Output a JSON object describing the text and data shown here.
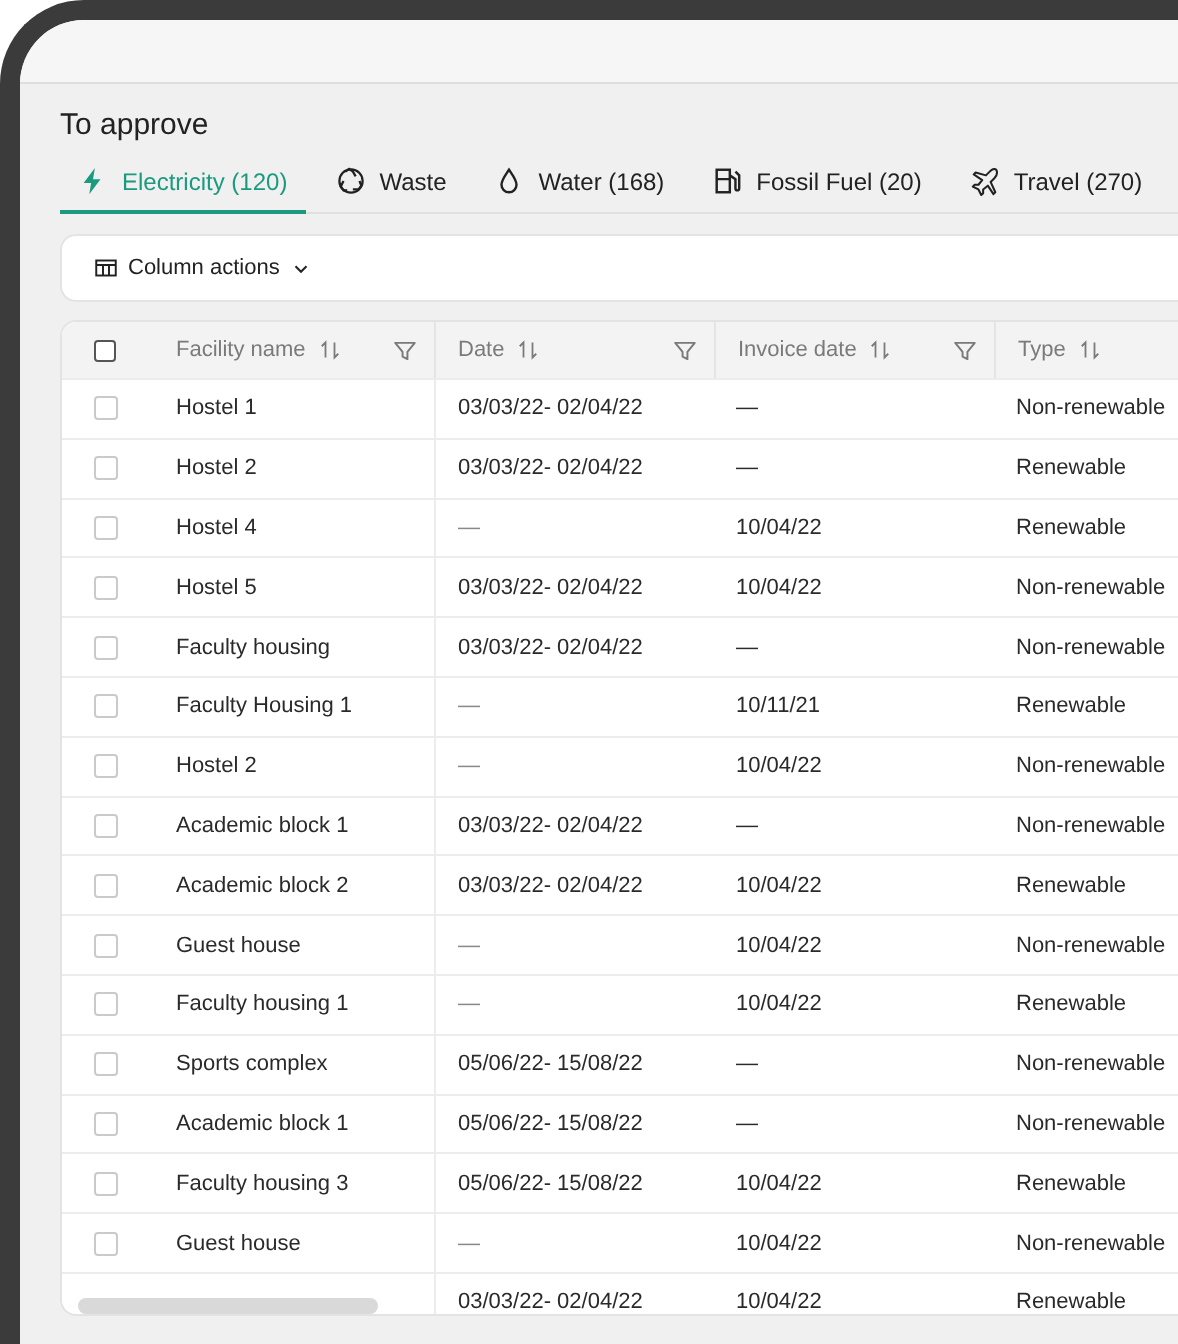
{
  "title": "To approve",
  "tabs": [
    {
      "label": "Electricity (120)",
      "kind": "electricity",
      "selected": true
    },
    {
      "label": "Waste",
      "kind": "waste",
      "selected": false
    },
    {
      "label": "Water (168)",
      "kind": "water",
      "selected": false
    },
    {
      "label": "Fossil Fuel (20)",
      "kind": "fuel",
      "selected": false
    },
    {
      "label": "Travel (270)",
      "kind": "travel",
      "selected": false
    }
  ],
  "toolbar": {
    "column_actions": "Column actions"
  },
  "table": {
    "select_all_checked": false,
    "columns": [
      {
        "label": "Facility name",
        "filter": true
      },
      {
        "label": "Date",
        "filter": true
      },
      {
        "label": "Invoice date",
        "filter": true
      },
      {
        "label": "Type",
        "filter": false
      }
    ],
    "rows": [
      {
        "checked": false,
        "cells": [
          "Hostel 1",
          "03/03/22- 02/04/22",
          "—",
          "Non-renewable"
        ]
      },
      {
        "checked": false,
        "cells": [
          "Hostel 2",
          "03/03/22- 02/04/22",
          "—",
          "Renewable"
        ]
      },
      {
        "checked": false,
        "cells": [
          "Hostel 4",
          "—",
          "10/04/22",
          "Renewable"
        ]
      },
      {
        "checked": false,
        "cells": [
          "Hostel 5",
          "03/03/22- 02/04/22",
          "10/04/22",
          "Non-renewable"
        ]
      },
      {
        "checked": false,
        "cells": [
          "Faculty housing",
          "03/03/22- 02/04/22",
          "—",
          "Non-renewable"
        ]
      },
      {
        "checked": false,
        "cells": [
          "Faculty Housing 1",
          "—",
          "10/11/21",
          "Renewable"
        ]
      },
      {
        "checked": false,
        "cells": [
          "Hostel 2",
          "—",
          "10/04/22",
          "Non-renewable"
        ]
      },
      {
        "checked": false,
        "cells": [
          "Academic block 1",
          "03/03/22- 02/04/22",
          "—",
          "Non-renewable"
        ]
      },
      {
        "checked": false,
        "cells": [
          "Academic block 2",
          "03/03/22- 02/04/22",
          "10/04/22",
          "Renewable"
        ]
      },
      {
        "checked": false,
        "cells": [
          "Guest house",
          "—",
          "10/04/22",
          "Non-renewable"
        ]
      },
      {
        "checked": false,
        "cells": [
          "Faculty housing 1",
          "—",
          "10/04/22",
          "Renewable"
        ]
      },
      {
        "checked": false,
        "cells": [
          "Sports complex",
          "05/06/22- 15/08/22",
          "—",
          "Non-renewable"
        ]
      },
      {
        "checked": false,
        "cells": [
          "Academic block 1",
          "05/06/22- 15/08/22",
          "—",
          "Non-renewable"
        ]
      },
      {
        "checked": false,
        "cells": [
          "Faculty housing 3",
          "05/06/22- 15/08/22",
          "10/04/22",
          "Renewable"
        ]
      },
      {
        "checked": false,
        "cells": [
          "Guest house",
          "—",
          "10/04/22",
          "Non-renewable"
        ]
      },
      {
        "cells": [
          null,
          "03/03/22- 02/04/22",
          "10/04/22",
          "Renewable"
        ]
      }
    ]
  }
}
